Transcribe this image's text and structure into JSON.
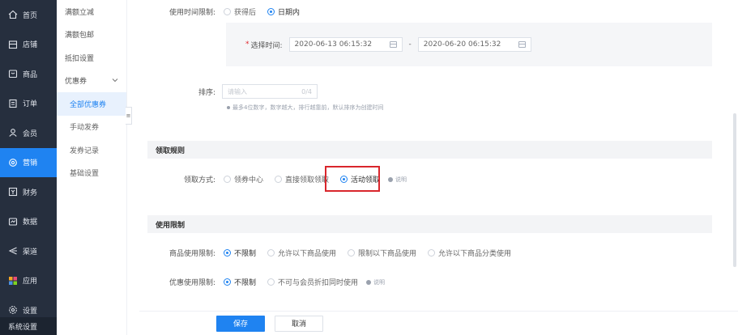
{
  "nav": {
    "items": [
      {
        "label": "首页",
        "icon": "home-icon"
      },
      {
        "label": "店铺",
        "icon": "store-icon"
      },
      {
        "label": "商品",
        "icon": "goods-icon"
      },
      {
        "label": "订单",
        "icon": "order-icon"
      },
      {
        "label": "会员",
        "icon": "member-icon"
      },
      {
        "label": "营销",
        "icon": "marketing-icon"
      },
      {
        "label": "财务",
        "icon": "finance-icon"
      },
      {
        "label": "数据",
        "icon": "data-icon"
      },
      {
        "label": "渠道",
        "icon": "channel-icon"
      },
      {
        "label": "应用",
        "icon": "apps-icon"
      },
      {
        "label": "设置",
        "icon": "settings-icon"
      }
    ],
    "bottom_label": "系统设置",
    "active_color": "#1f83f1"
  },
  "submenu": {
    "items": [
      "满额立减",
      "满额包邮",
      "抵扣设置"
    ],
    "group_label": "优惠券",
    "children": [
      "全部优惠券",
      "手动发券",
      "发券记录",
      "基础设置"
    ]
  },
  "form": {
    "time_limit_label": "使用时间限制:",
    "time_options": [
      "获得后",
      "日期内"
    ],
    "select_time_label": "选择时间:",
    "start_date": "2020-06-13 06:15:32",
    "end_date": "2020-06-20 06:15:32",
    "date_separator": "-",
    "sort_label": "排序:",
    "sort_placeholder": "请输入",
    "sort_counter": "0/4",
    "sort_hint": "最多4位数字，数字越大，排行越靠前，默认排序为创建时间"
  },
  "claim_rules": {
    "title": "领取规则",
    "method_label": "领取方式:",
    "options": [
      "领券中心",
      "直接领取领取",
      "活动领取"
    ],
    "help_text": "说明"
  },
  "usage_limits": {
    "title": "使用限制",
    "goods_label": "商品使用限制:",
    "goods_options": [
      "不限制",
      "允许以下商品使用",
      "限制以下商品使用",
      "允许以下商品分类使用"
    ],
    "discount_label": "优惠使用限制:",
    "discount_options": [
      "不限制",
      "不可与会员折扣同时使用"
    ],
    "help_text": "说明"
  },
  "footer": {
    "save_label": "保存",
    "cancel_label": "取消"
  },
  "colors": {
    "primary": "#1f83f1",
    "highlight": "#d9262c",
    "sidebar_bg": "#262f3e"
  }
}
